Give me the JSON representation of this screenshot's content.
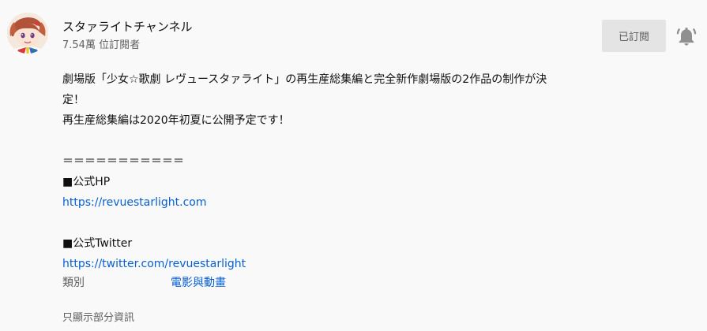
{
  "channel": {
    "name": "スタァライトチャンネル",
    "subscribers": "7.54萬 位訂閱者",
    "avatar_icon": "anime-character-avatar"
  },
  "actions": {
    "subscribe_label": "已訂閱",
    "bell_icon": "bell-icon"
  },
  "description": {
    "line1": "劇場版「少女☆歌劇 レヴュースタァライト」の再生産総集編と完全新作劇場版の2作品の制作が決",
    "line2": "定！",
    "line3": "再生産総集編は2020年初夏に公開予定です！",
    "divider": "＝＝＝＝＝＝＝＝＝＝＝",
    "hp_label": "■公式HP",
    "hp_url": "https://revuestarlight.com",
    "twitter_label": "■公式Twitter",
    "twitter_url": "https://twitter.com/revuestarlight"
  },
  "meta": {
    "category_label": "類別",
    "category_value": "電影與動畫"
  },
  "footer": {
    "show_less": "只顯示部分資訊"
  }
}
